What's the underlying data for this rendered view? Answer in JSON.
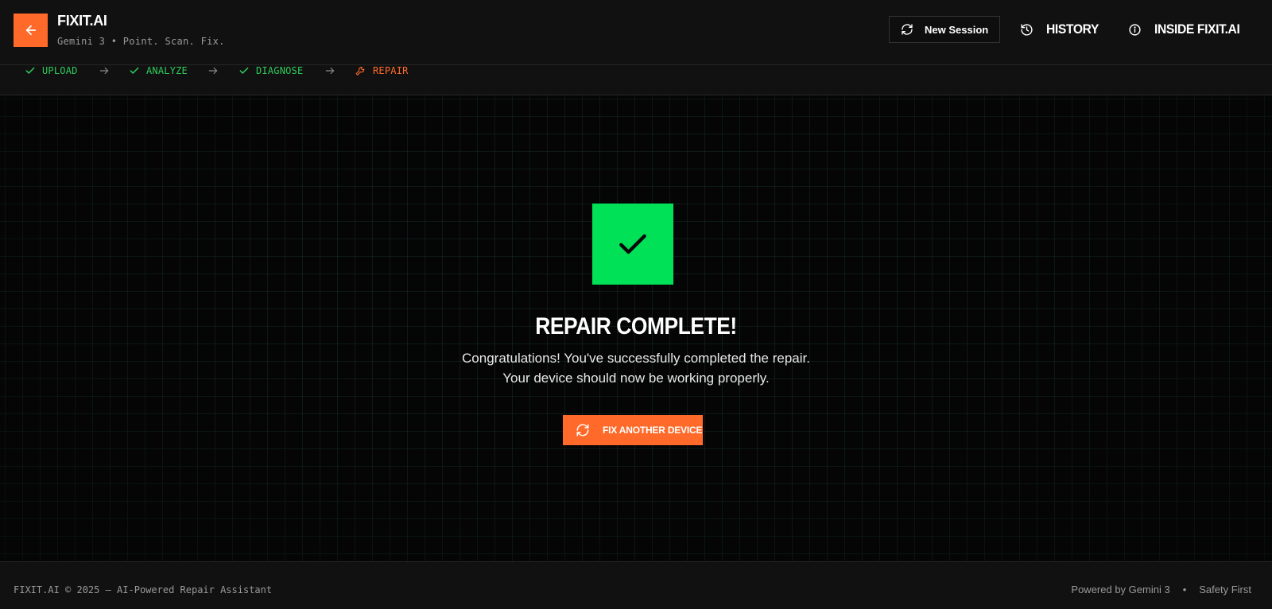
{
  "header": {
    "brand_title": "FIXIT.AI",
    "brand_subtitle": "Gemini 3 • Point. Scan. Fix.",
    "new_session_label": "New Session",
    "history_label": "HISTORY",
    "inside_label": "INSIDE FIXIT.AI"
  },
  "stepper": {
    "steps": [
      {
        "label": "UPLOAD",
        "status": "done",
        "icon": "check-icon"
      },
      {
        "label": "ANALYZE",
        "status": "done",
        "icon": "check-icon"
      },
      {
        "label": "DIAGNOSE",
        "status": "done",
        "icon": "check-icon"
      },
      {
        "label": "REPAIR",
        "status": "active",
        "icon": "wrench-icon"
      }
    ]
  },
  "main": {
    "title": "REPAIR COMPLETE!",
    "message_line1": "Congratulations! You've successfully completed the repair.",
    "message_line2": "Your device should now be working properly.",
    "fix_button_label": "FIX ANOTHER DEVICE"
  },
  "footer": {
    "left_text": "FIXIT.AI © 2025 — AI-Powered Repair Assistant",
    "powered_by": "Powered by Gemini 3",
    "separator": "•",
    "safety": "Safety First"
  },
  "colors": {
    "accent": "#ff6a2a",
    "success": "#00e157",
    "step_done": "#2ecc5b",
    "background": "#050505"
  }
}
